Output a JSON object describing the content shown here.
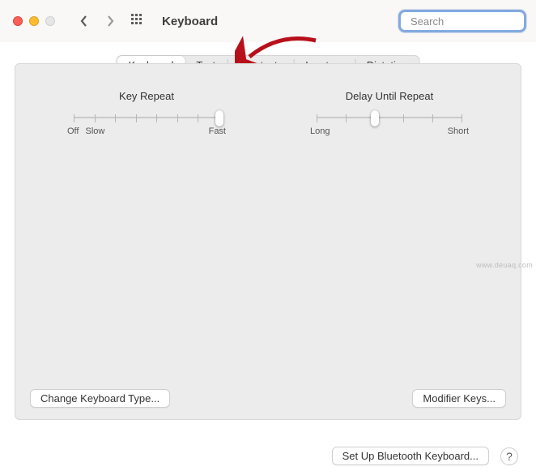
{
  "window": {
    "title": "Keyboard"
  },
  "search": {
    "placeholder": "Search",
    "value": ""
  },
  "tabs": [
    {
      "label": "Keyboard",
      "active": true
    },
    {
      "label": "Text",
      "active": false
    },
    {
      "label": "Shortcuts",
      "active": false
    },
    {
      "label": "Input Sources",
      "active": false
    },
    {
      "label": "Dictation",
      "active": false
    }
  ],
  "slider_left": {
    "title": "Key Repeat",
    "min_label_1": "Off",
    "min_label_2": "Slow",
    "max_label": "Fast",
    "ticks": 8,
    "value_index": 7
  },
  "slider_right": {
    "title": "Delay Until Repeat",
    "min_label": "Long",
    "max_label": "Short",
    "ticks": 6,
    "value_index": 2
  },
  "buttons": {
    "change_keyboard_type": "Change Keyboard Type...",
    "modifier_keys": "Modifier Keys...",
    "setup_bluetooth": "Set Up Bluetooth Keyboard..."
  },
  "annotation": {
    "arrow_target": "Shortcuts",
    "arrow_color": "#b8101a"
  },
  "watermark": "www.deuaq.com"
}
